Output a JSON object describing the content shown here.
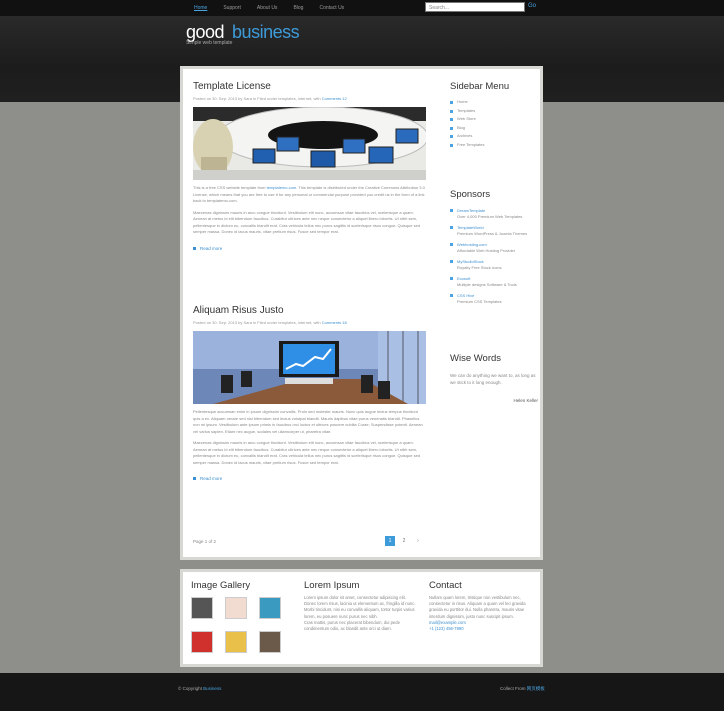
{
  "nav": {
    "items": [
      "Home",
      "Support",
      "About Us",
      "Blog",
      "Contact Us"
    ],
    "active": "Home"
  },
  "search": {
    "placeholder": "Search...",
    "go_label": "Go"
  },
  "logo": {
    "part1": "good",
    "part2": "business",
    "slogan": "Simple web template"
  },
  "posts": [
    {
      "title": "Template License",
      "meta": "Posted on 30. Sep, 2013 by Sara in Filed under templates, internet, with",
      "comments": "Comments 12",
      "text1a": "This is a free CSS website template from",
      "text1_link": "templatemo.com",
      "text1b": ". This template is distributed under the Creative Commons Attribution 3.0 License, which means that you are free to use it for any personal or commercial purpose provided you credit us in the form of a link back to templatemo.com.",
      "text2": "Maecenas dignissim mauris in arcu congue tincidunt. Vestibulum elit nunc, accumsan vitae faucibus vel, scelerisque a quam. Aenean at metus id elit bibendum faucibus. Curabitur ultrices ante nec neque consectetur a aliquet libero lobortis. Ut nibh sem, pellentesque in dictum eu, convallis blandit erat. Cras vehicula tellus nec purus sagittis id scelerisque risus congue. Quisque sed semper massa. Donec id lacus mauris, vitae pretium risus. Fusce sed tempor erat.",
      "readmore": "Read more"
    },
    {
      "title": "Aliquam Risus Justo",
      "meta": "Posted on 30. Sep, 2013 by Sara in Filed under templates, internet, with",
      "comments": "Comments 18",
      "text1": "Pellentesque accumsan enim in ipsum dignissim convallis. Proin sed molestie mauris. Nunc quis augue lectus tempus tincidunt quis a ex. Aliquam ornare sed nisi bibendum sed lectus volutpat blandit. Mauris dapibus vitae purus venenatis blandit. Phasellus non mi ipsum. Vestibulum ante ipsum primis in faucibus orci luctus et ultrices posuere cubilia Curae; Suspendisse potenti. Aenean vel varius sapien. Etiam nec augue, sodales vel ullamcorper ut, pharetra vitae.",
      "text2": "Maecenas dignissim mauris in arcu congue tincidunt. Vestibulum elit nunc, accumsan vitae faucibus vel, scelerisque a quam. Aenean at metus id elit bibendum faucibus. Curabitur ultrices ante nec neque consectetur a aliquet libero lobortis. Ut nibh sem, pellentesque in dictum eu, convallis blandit erat. Cras vehicula tellus nec purus sagittis id scelerisque risus congue. Quisque sed semper massa. Donec id lacus mauris, vitae pretium risus. Fusce sed tempor erat.",
      "readmore": "Read more"
    }
  ],
  "pagination": {
    "label": "Page 1 of 2",
    "pages": [
      "1",
      "2"
    ],
    "next": "›"
  },
  "sidebar": {
    "menu_title": "Sidebar Menu",
    "menu": [
      "Home",
      "Templates",
      "Web Store",
      "Blog",
      "Archives",
      "Free Templates"
    ],
    "sponsors_title": "Sponsors",
    "sponsors": [
      {
        "name": "DreamTemplate",
        "desc": "Over 4,000 Premium Web Templates"
      },
      {
        "name": "TemplateWorld",
        "desc": "Premium WordPress & Joomla Themes"
      },
      {
        "name": "Webhosting.com",
        "desc": "Affordable Web Hosting Provider"
      },
      {
        "name": "MyStudioStock",
        "desc": "Royalty Free Stock Icons"
      },
      {
        "name": "Ecosoft",
        "desc": "Multiple designs Software & Tools"
      },
      {
        "name": "CSS Hive",
        "desc": "Premium CSS Templates"
      }
    ],
    "words_title": "Wise Words",
    "quote": "We can do anything we want to, as long as we stick to it long enough.",
    "quote_author": "Helen Keller"
  },
  "footer_box": {
    "gallery_title": "Image Gallery",
    "lorem_title": "Lorem Ipsum",
    "lorem_lines": [
      "Lorem ipsum dolor sit amet, consectetur adipiscing elit.",
      "Donec lorem risus, lacinia ut elementum ac, fringilla id nunc.",
      "Morbi tincidunt, nisi eu convallis aliquam, tortor turpis varius lorem, eu posuere nunc purus nec nibh.",
      "Cras mattis, purus nec placerat bibendum, dui pede condimentum odio, ac blandit ante orci ut diam."
    ],
    "contact_title": "Contact",
    "contact_text": "Nullam quam lorem, tristique non vestibulum nec, consectetur in risus. Aliquam a quam vel leo gravida gravida eu porttitor dui. Nulla pharetra, mauris vitae interdum dignissim, justo nunc suscipit ipsum.",
    "contact_email": "mail@example.com",
    "contact_phone": "+1 (123) 456-7890"
  },
  "bottom": {
    "copyright": "© Copyright",
    "company": "Business",
    "credit": "Collect From",
    "credit_link": "网页模板"
  },
  "colors": {
    "accent": "#3d9bd9",
    "background": "#8e8e8b",
    "header": "#1c1c1c"
  }
}
